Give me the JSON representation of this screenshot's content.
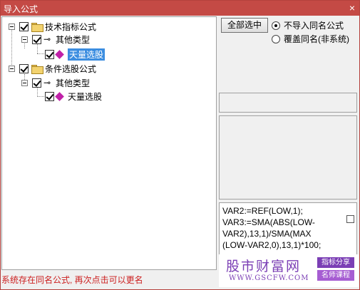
{
  "window": {
    "title": "导入公式",
    "close_glyph": "×"
  },
  "tree": {
    "groups": [
      {
        "label": "技术指标公式",
        "sub": "其他类型",
        "leaf": "天量选股"
      },
      {
        "label": "条件选股公式",
        "sub": "其他类型",
        "leaf": "天量选股"
      }
    ]
  },
  "controls": {
    "select_all": "全部选中",
    "radio_no_import": "不导入同名公式",
    "radio_overwrite": "覆盖同名(非系统)"
  },
  "formula_lines": [
    "VAR2:=REF(LOW,1);",
    "VAR3:=SMA(ABS(LOW-",
    "VAR2),13,1)/SMA(MAX",
    "(LOW-VAR2,0),13,1)*100;"
  ],
  "status_text": "系统存在同名公式, 再次点击可以更名",
  "watermark": {
    "title": "股市财富网",
    "url": "WWW.GSCFW.COM",
    "tag1": "指标分享",
    "tag2": "名师课程"
  }
}
